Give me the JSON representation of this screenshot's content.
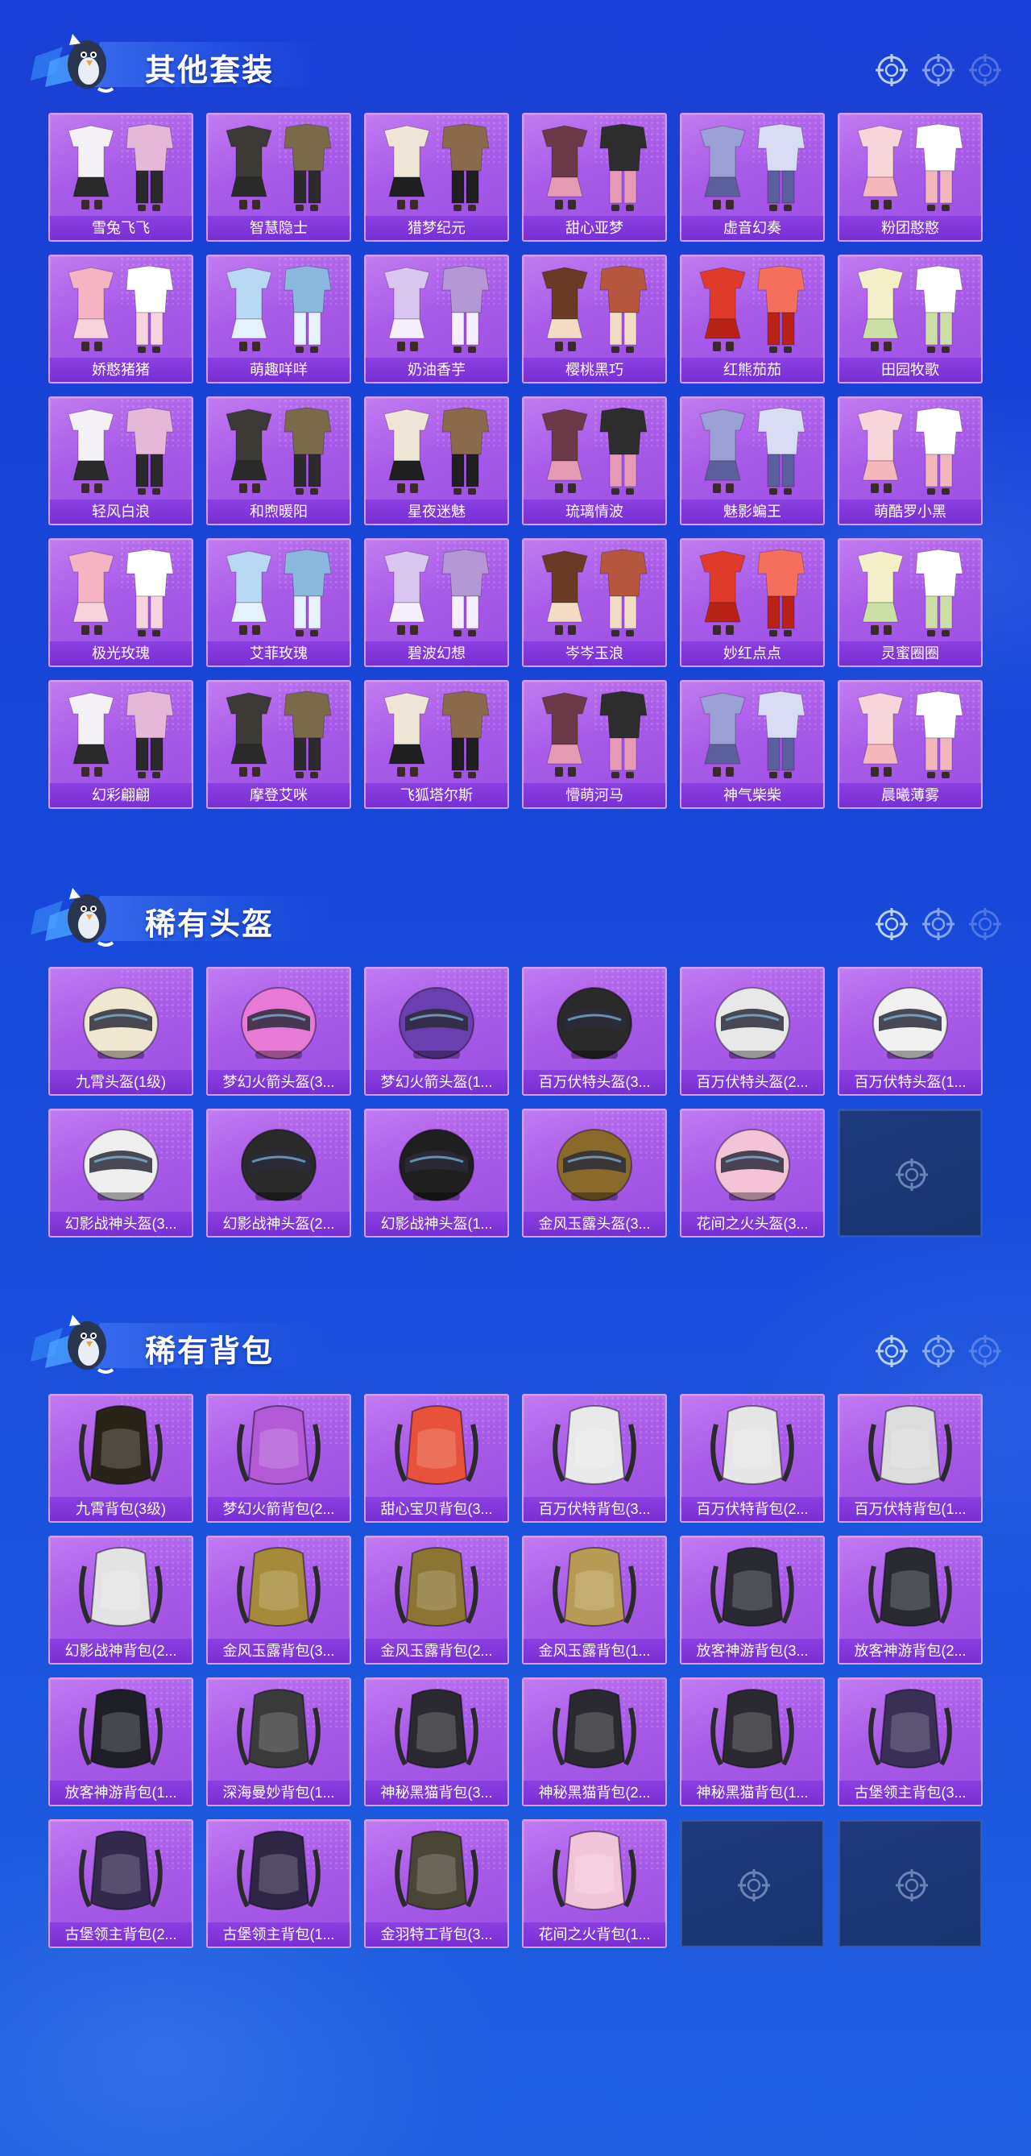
{
  "theme": {
    "accent": "#a85ae8",
    "label_bg": "#7a2fd6",
    "bg": "#1746d8"
  },
  "sections": [
    {
      "title": "其他套装",
      "kind": "outfit",
      "items": [
        "雪兔飞飞",
        "智慧隐士",
        "猎梦纪元",
        "甜心亚梦",
        "虚音幻奏",
        "粉团憨憨",
        "娇憨猪猪",
        "萌趣咩咩",
        "奶油香芋",
        "樱桃黑巧",
        "红熊茄茄",
        "田园牧歌",
        "轻风白浪",
        "和煦暖阳",
        "星夜迷魅",
        "琉璃情波",
        "魅影蝙王",
        "萌酷罗小黑",
        "极光玫瑰",
        "艾菲玫瑰",
        "碧波幻想",
        "岑岑玉浪",
        "妙红点点",
        "灵蜜圈圈",
        "幻彩翩翩",
        "摩登艾咪",
        "飞狐塔尔斯",
        "懵萌河马",
        "神气柴柴",
        "晨曦薄雾"
      ],
      "empty_slots": 0
    },
    {
      "title": "稀有头盔",
      "kind": "helmet",
      "items": [
        "九霄头盔(1级)",
        "梦幻火箭头盔(3...",
        "梦幻火箭头盔(1...",
        "百万伏特头盔(3...",
        "百万伏特头盔(2...",
        "百万伏特头盔(1...",
        "幻影战神头盔(3...",
        "幻影战神头盔(2...",
        "幻影战神头盔(1...",
        "金风玉露头盔(3...",
        "花间之火头盔(3..."
      ],
      "empty_slots": 1
    },
    {
      "title": "稀有背包",
      "kind": "backpack",
      "items": [
        "九霄背包(3级)",
        "梦幻火箭背包(2...",
        "甜心宝贝背包(3...",
        "百万伏特背包(3...",
        "百万伏特背包(2...",
        "百万伏特背包(1...",
        "幻影战神背包(2...",
        "金风玉露背包(3...",
        "金风玉露背包(2...",
        "金风玉露背包(1...",
        "放客神游背包(3...",
        "放客神游背包(2...",
        "放客神游背包(1...",
        "深海曼妙背包(1...",
        "神秘黑猫背包(3...",
        "神秘黑猫背包(2...",
        "神秘黑猫背包(1...",
        "古堡领主背包(3...",
        "古堡领主背包(2...",
        "古堡领主背包(1...",
        "金羽特工背包(3...",
        "花间之火背包(1..."
      ],
      "empty_slots": 2
    }
  ],
  "icons": {
    "header_mascot": "penguin-mascot-icon",
    "decor": "reticle-icon",
    "empty": "reticle-icon"
  }
}
